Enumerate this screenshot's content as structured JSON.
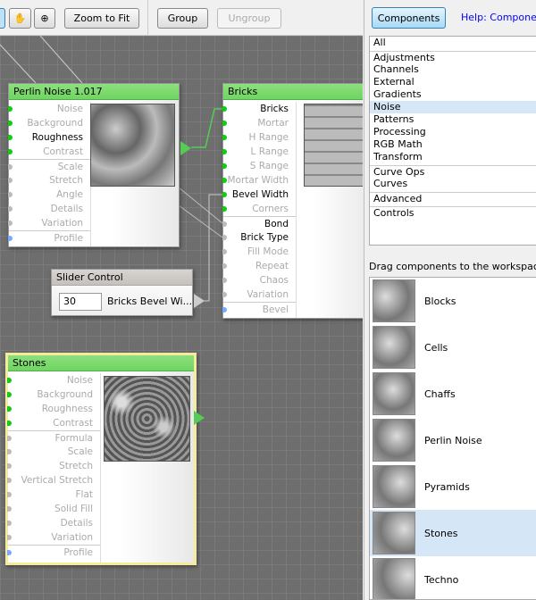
{
  "toolbar": {
    "zoom_fit": "Zoom to Fit",
    "group": "Group",
    "ungroup": "Ungroup"
  },
  "nodes": {
    "perlin": {
      "title": "Perlin Noise 1.017",
      "inputs": [
        {
          "label": "Noise",
          "active": false
        },
        {
          "label": "Background",
          "active": false
        },
        {
          "label": "Roughness",
          "active": true
        },
        {
          "label": "Contrast",
          "active": false
        },
        {
          "label": "Scale",
          "active": false
        },
        {
          "label": "Stretch",
          "active": false
        },
        {
          "label": "Angle",
          "active": false
        },
        {
          "label": "Details",
          "active": false
        },
        {
          "label": "Variation",
          "active": false
        },
        {
          "label": "Profile",
          "active": false
        }
      ]
    },
    "bricks": {
      "title": "Bricks",
      "inputs": [
        {
          "label": "Bricks",
          "active": true
        },
        {
          "label": "Mortar",
          "active": false
        },
        {
          "label": "H Range",
          "active": false
        },
        {
          "label": "L Range",
          "active": false
        },
        {
          "label": "S Range",
          "active": false
        },
        {
          "label": "Mortar Width",
          "active": false
        },
        {
          "label": "Bevel Width",
          "active": true
        },
        {
          "label": "Corners",
          "active": false
        },
        {
          "label": "Bond",
          "active": true
        },
        {
          "label": "Brick Type",
          "active": true
        },
        {
          "label": "Fill Mode",
          "active": false
        },
        {
          "label": "Repeat",
          "active": false
        },
        {
          "label": "Chaos",
          "active": false
        },
        {
          "label": "Variation",
          "active": false
        },
        {
          "label": "Bevel",
          "active": false
        }
      ]
    },
    "slider": {
      "title": "Slider Control",
      "value": "30",
      "label": "Bricks Bevel Wi..."
    },
    "stones": {
      "title": "Stones",
      "inputs": [
        {
          "label": "Noise",
          "active": false
        },
        {
          "label": "Background",
          "active": false
        },
        {
          "label": "Roughness",
          "active": false
        },
        {
          "label": "Contrast",
          "active": false
        },
        {
          "label": "Formula",
          "active": false
        },
        {
          "label": "Scale",
          "active": false
        },
        {
          "label": "Stretch",
          "active": false
        },
        {
          "label": "Vertical Stretch",
          "active": false
        },
        {
          "label": "Flat",
          "active": false
        },
        {
          "label": "Solid Fill",
          "active": false
        },
        {
          "label": "Details",
          "active": false
        },
        {
          "label": "Variation",
          "active": false
        },
        {
          "label": "Profile",
          "active": false
        }
      ]
    }
  },
  "panel": {
    "components_btn": "Components",
    "help": "Help: Componen",
    "categories": [
      "All",
      "Adjustments",
      "Channels",
      "External",
      "Gradients",
      "Noise",
      "Patterns",
      "Processing",
      "RGB Math",
      "Transform",
      "Curve Ops",
      "Curves",
      "Advanced",
      "Controls"
    ],
    "selected_category": "Noise",
    "drag_label": "Drag components to the workspace:",
    "components": [
      "Blocks",
      "Cells",
      "Chaffs",
      "Perlin Noise",
      "Pyramids",
      "Stones",
      "Techno"
    ],
    "selected_component": "Stones"
  }
}
